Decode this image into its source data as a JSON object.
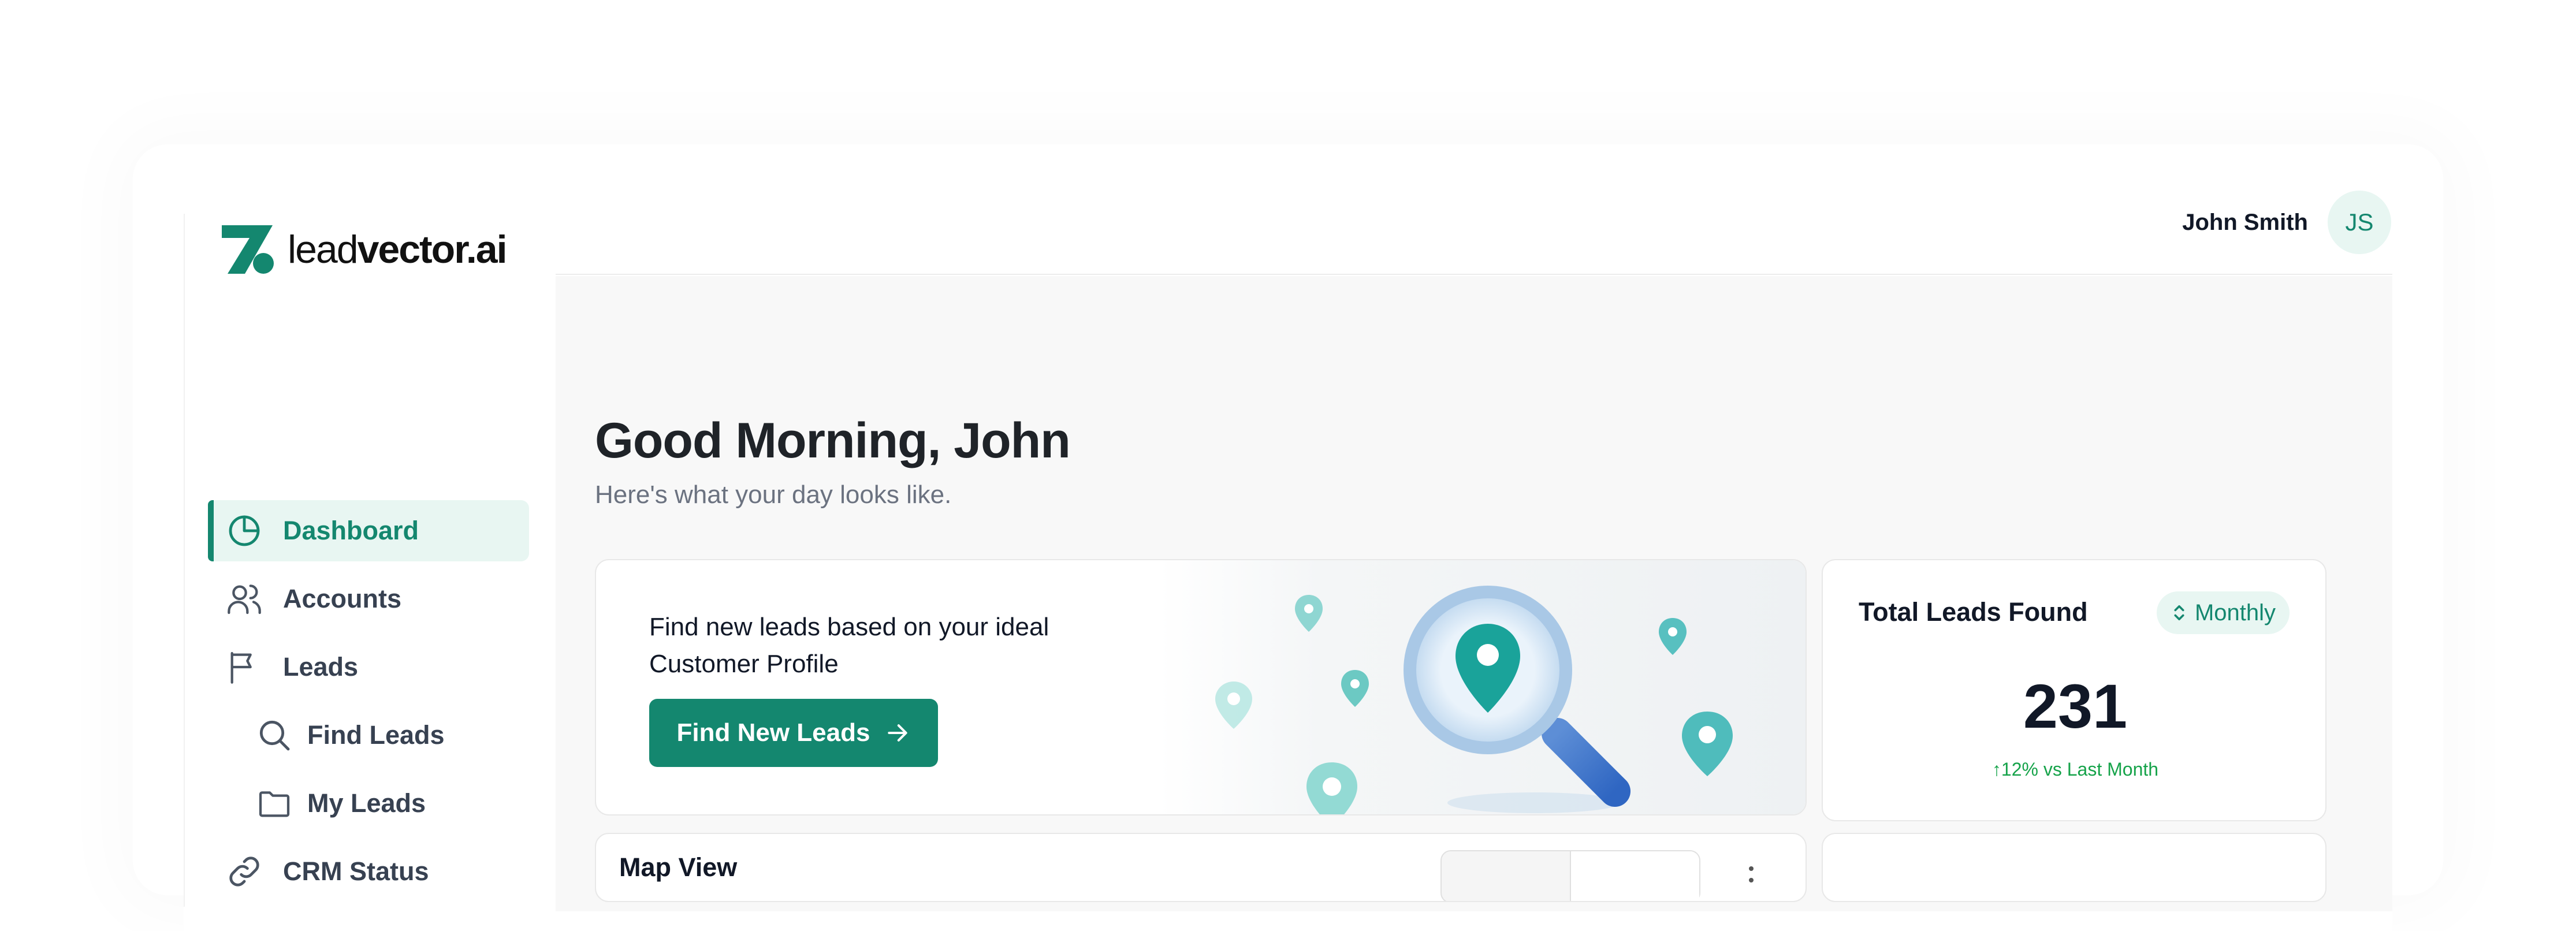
{
  "brand": {
    "name_light": "lead",
    "name_bold": "vector.ai",
    "accent_color": "#14876f"
  },
  "user": {
    "name": "John Smith",
    "initials": "JS"
  },
  "sidebar": {
    "items": [
      {
        "label": "Dashboard",
        "icon": "pie-chart-icon",
        "active": true
      },
      {
        "label": "Accounts",
        "icon": "users-icon"
      },
      {
        "label": "Leads",
        "icon": "flag-icon"
      },
      {
        "label": "Find Leads",
        "icon": "search-icon",
        "sub": true
      },
      {
        "label": "My Leads",
        "icon": "folder-icon",
        "sub": true
      },
      {
        "label": "CRM Status",
        "icon": "link-icon"
      }
    ]
  },
  "main": {
    "greeting": "Good Morning, John",
    "subgreeting": "Here's what your day looks like.",
    "find_card": {
      "text": "Find new leads based on your ideal Customer Profile",
      "button": "Find New Leads"
    },
    "total_card": {
      "title": "Total Leads Found",
      "period": "Monthly",
      "value": "231",
      "delta": "12% vs Last Month"
    },
    "map_card": {
      "title": "Map View"
    }
  }
}
